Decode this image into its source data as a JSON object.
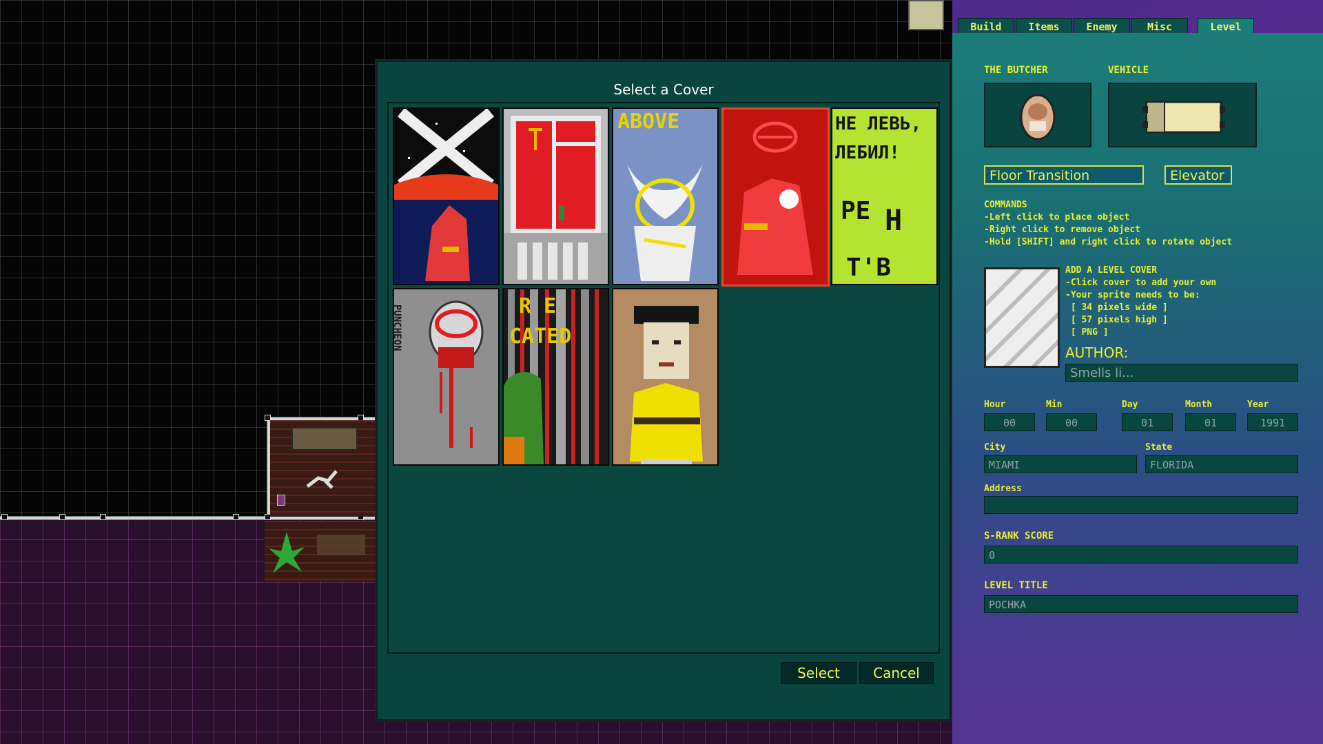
{
  "dialog": {
    "title": "Select a Cover",
    "select_label": "Select",
    "cancel_label": "Cancel",
    "covers": [
      {
        "name": "cover-1"
      },
      {
        "name": "cover-2"
      },
      {
        "name": "cover-3"
      },
      {
        "name": "cover-4"
      },
      {
        "name": "cover-5"
      },
      {
        "name": "cover-6"
      },
      {
        "name": "cover-7"
      },
      {
        "name": "cover-8"
      }
    ],
    "cover_text": {
      "above": "ABOVE",
      "he_line1": "HE ЛEBЬ,",
      "he_line2": "ЛEБИЛ!",
      "he_line3": "PE",
      "he_line4": "H",
      "he_line5": "T'B",
      "re_line1": "R E",
      "re_line2": "CATED",
      "vertical": "PUNCHEON"
    }
  },
  "tabs": [
    "Build",
    "Items",
    "Enemy",
    "Misc",
    "Level"
  ],
  "active_tab": "Level",
  "panel": {
    "character_label": "THE BUTCHER",
    "vehicle_label": "VEHICLE",
    "floor_transition": "Floor Transition",
    "elevator": "Elevator",
    "commands_title": "COMMANDS",
    "commands": [
      "-Left click to place object",
      "-Right click to remove object",
      "-Hold [SHIFT] and right click to rotate object"
    ],
    "cover_help_title": "ADD A LEVEL COVER",
    "cover_help": [
      "-Click cover to add your own",
      "-Your sprite needs to be:",
      " [ 34 pixels wide ]",
      " [ 57 pixels high ]",
      " [ PNG ]"
    ],
    "author_label": "AUTHOR:",
    "author_value": "Smells li...",
    "hour_label": "Hour",
    "hour_value": "00",
    "min_label": "Min",
    "min_value": "00",
    "day_label": "Day",
    "day_value": "01",
    "month_label": "Month",
    "month_value": "01",
    "year_label": "Year",
    "year_value": "1991",
    "city_label": "City",
    "city_value": "MIAMI",
    "state_label": "State",
    "state_value": "FLORIDA",
    "address_label": "Address",
    "address_value": "",
    "srank_label": "S-RANK SCORE",
    "srank_value": "0",
    "title_label": "LEVEL TITLE",
    "title_value": "POCHKA"
  },
  "colors": {
    "accent_yellow": "#e8ef2e",
    "dialog_bg": "#09443e",
    "panel_purple": "#5a2f95"
  }
}
